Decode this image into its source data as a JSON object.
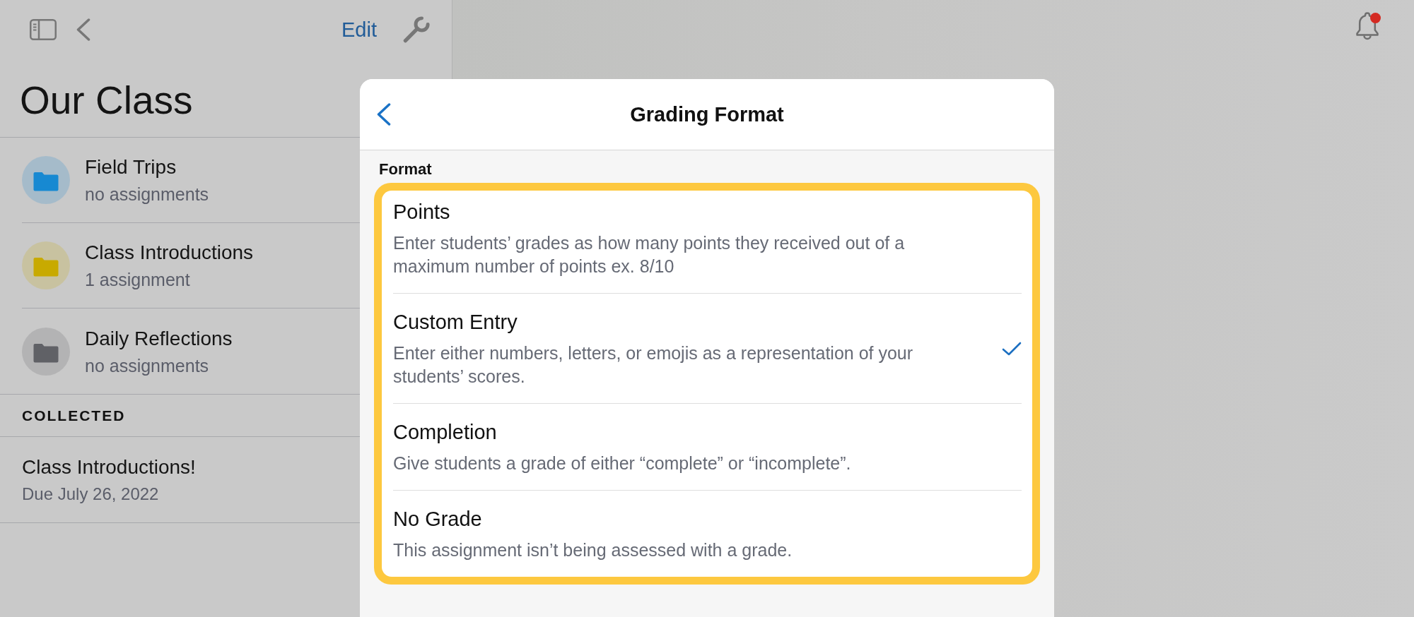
{
  "toolbar": {
    "edit_label": "Edit"
  },
  "sidebar": {
    "title": "Our Class",
    "folders": [
      {
        "name": "Field Trips",
        "subtitle": "no assignments",
        "color": "#1789d2"
      },
      {
        "name": "Class Introductions",
        "subtitle": "1 assignment",
        "color": "#c8aa00"
      },
      {
        "name": "Daily Reflections",
        "subtitle": "no assignments",
        "color": "#606166"
      }
    ],
    "collected": {
      "heading": "COLLECTED",
      "items": [
        {
          "title": "Class Introductions!",
          "due": "Due July 26, 2022"
        }
      ]
    }
  },
  "notifications": {
    "has_unread": true
  },
  "dialog": {
    "title": "Grading Format",
    "section_label": "Format",
    "highlighted": true,
    "options": [
      {
        "title": "Points",
        "description": "Enter students’ grades as how many points they received out of a maximum number of points ex. 8/10",
        "selected": false
      },
      {
        "title": "Custom Entry",
        "description": "Enter either numbers, letters, or emojis as a representation of your students’ scores.",
        "selected": true
      },
      {
        "title": "Completion",
        "description": "Give students a grade of either “complete” or “incomplete”.",
        "selected": false
      },
      {
        "title": "No Grade",
        "description": "This assignment isn’t being assessed with a grade.",
        "selected": false
      }
    ]
  }
}
